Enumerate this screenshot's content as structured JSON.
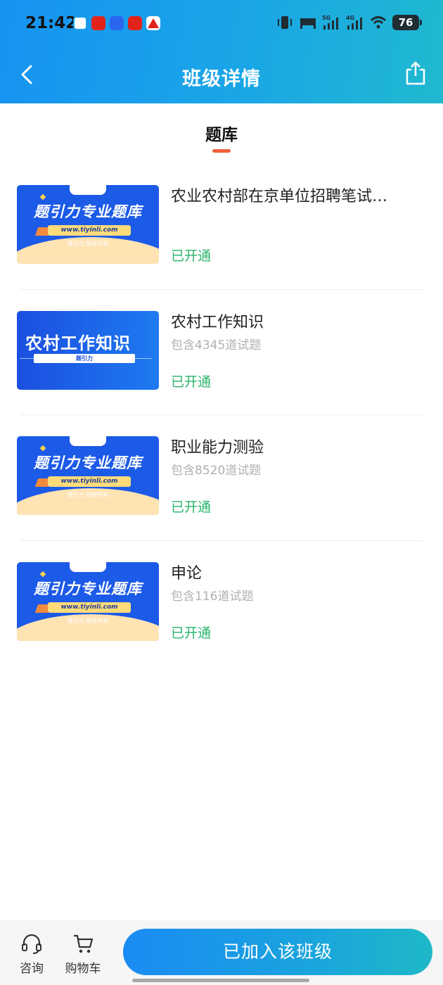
{
  "status_bar": {
    "time": "21:42",
    "battery": "76",
    "notification_icons": [
      "message-icon",
      "xiaohongshu-icon",
      "app-icon",
      "xiaohongshu-icon",
      "app-icon"
    ]
  },
  "nav": {
    "title": "班级详情",
    "back_icon": "chevron-left-icon",
    "share_icon": "share-icon"
  },
  "tab": {
    "label": "题库",
    "underline_color": "#f0613e"
  },
  "items": [
    {
      "title": "农业农村部在京单位招聘笔试…",
      "count": "",
      "status": "已开通",
      "thumb": {
        "big": "题引力专业题库",
        "url": "www.tiyinli.com",
        "rights": "题引力 版权所有",
        "badge": "题引力"
      }
    },
    {
      "title": "农村工作知识",
      "count": "包含4345道试题",
      "status": "已开通",
      "thumb": {
        "big": "农村工作知识",
        "bar": "题引力"
      }
    },
    {
      "title": "职业能力测验",
      "count": "包含8520道试题",
      "status": "已开通",
      "thumb": {
        "big": "题引力专业题库",
        "url": "www.tiyinli.com",
        "rights": "题引力 版权所有",
        "badge": "题引力"
      }
    },
    {
      "title": "申论",
      "count": "包含116道试题",
      "status": "已开通",
      "thumb": {
        "big": "题引力专业题库",
        "url": "www.tiyinli.com",
        "rights": "题引力 版权所有",
        "badge": "题引力"
      }
    }
  ],
  "bottom_bar": {
    "consult_label": "咨询",
    "cart_label": "购物车",
    "join_label": "已加入该班级"
  },
  "colors": {
    "header_start": "#1693f2",
    "header_end": "#20b9cf",
    "status_green": "#29b36a"
  }
}
